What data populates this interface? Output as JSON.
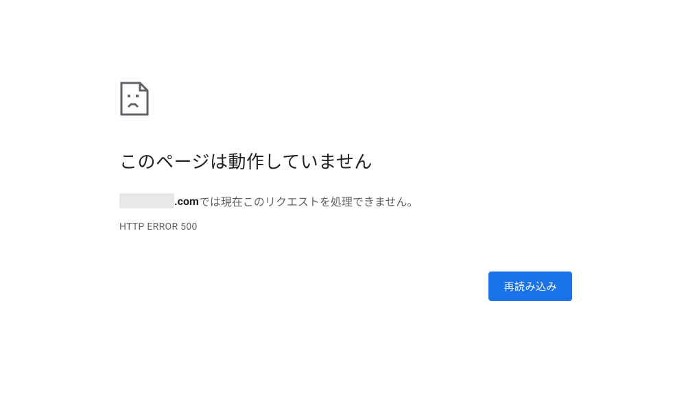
{
  "error": {
    "heading": "このページは動作していません",
    "domain_suffix": ".com",
    "message_rest": " では現在このリクエストを処理できません。",
    "error_code": "HTTP ERROR 500",
    "reload_label": "再読み込み"
  }
}
